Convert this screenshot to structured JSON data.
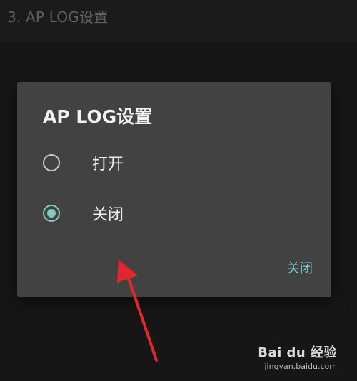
{
  "page": {
    "header_title": "3. AP LOG设置"
  },
  "dialog": {
    "title": "AP LOG设置",
    "options": [
      {
        "label": "打开",
        "selected": false
      },
      {
        "label": "关闭",
        "selected": true
      }
    ],
    "action_label": "关闭"
  },
  "annotation": {
    "arrow_color": "#e3262e"
  },
  "watermark": {
    "logo_text": "Bai du 经验",
    "url_text": "jingyan.baidu.com"
  },
  "colors": {
    "accent": "#80cbc4",
    "dialog_bg": "#424242",
    "screen_bg": "#1b1b1b"
  }
}
